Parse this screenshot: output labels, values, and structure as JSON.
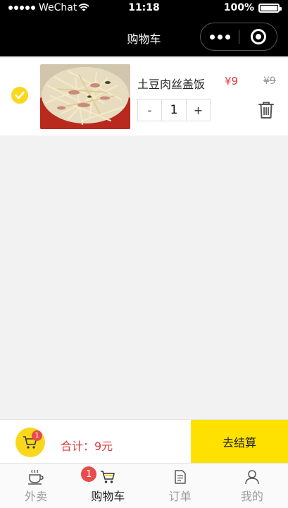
{
  "status_bar": {
    "carrier": "WeChat",
    "time": "11:18",
    "battery": "100%"
  },
  "nav": {
    "title": "购物车"
  },
  "cart_item": {
    "name": "土豆肉丝盖饭",
    "price": "¥9",
    "original_price": "¥9",
    "quantity": "1",
    "minus_label": "-",
    "plus_label": "+",
    "selected": true
  },
  "checkout": {
    "badge_count": "1",
    "total": "合计：9元",
    "pay_label": "去结算"
  },
  "tabbar": {
    "items": [
      {
        "label": "外卖",
        "icon": "coffee-icon",
        "active": false
      },
      {
        "label": "购物车",
        "icon": "cart-icon",
        "active": true,
        "badge": "1"
      },
      {
        "label": "订单",
        "icon": "document-icon",
        "active": false
      },
      {
        "label": "我的",
        "icon": "user-icon",
        "active": false
      }
    ]
  },
  "colors": {
    "accent_yellow": "#ffe100",
    "check_yellow": "#f9d71c",
    "price_red": "#e23b3b",
    "badge_red": "#e84b4b"
  }
}
